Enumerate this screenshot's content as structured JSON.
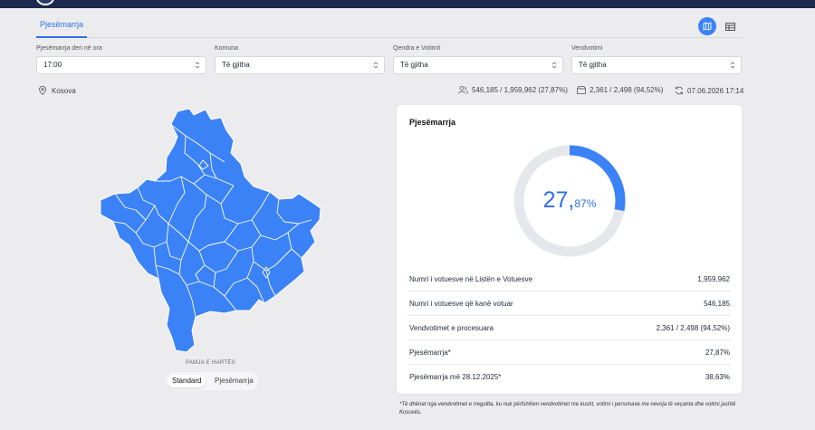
{
  "tabs": {
    "active": "Pjesëmarrja"
  },
  "filters": [
    {
      "label": "Pjesëmarrja deri në ora",
      "value": "17:00"
    },
    {
      "label": "Komuna",
      "value": "Të gjitha"
    },
    {
      "label": "Qendra e Votimit",
      "value": "Të gjitha"
    },
    {
      "label": "Vendvotimi",
      "value": "Të gjitha"
    }
  ],
  "status": {
    "location": "Kosova",
    "voters": "546,185 / 1,959,962 (27,87%)",
    "stations": "2,361 / 2,498 (94,52%)",
    "updated": "07.06.2026 17:14"
  },
  "map": {
    "view_label": "PAMJA E HARTËS",
    "toggle_standard": "Standard",
    "toggle_turnout": "Pjesëmarrja",
    "fill_color": "#3b82f6"
  },
  "card": {
    "title": "Pjesëmarrja",
    "turnout_fraction": 0.2787,
    "turnout_int": "27,",
    "turnout_dec": "87%",
    "rows": [
      {
        "label": "Numri i votuesve në Listën e Votuesve",
        "value": "1,959,962"
      },
      {
        "label": "Numri i votuesve që kanë votuar",
        "value": "546,185"
      },
      {
        "label": "Vendvotimet e procesuara",
        "value": "2,361 / 2,498 (94,52%)"
      },
      {
        "label": "Pjesëmarrja*",
        "value": "27,87%"
      },
      {
        "label": "Pjesëmarrja më 28.12.2025*",
        "value": "38,63%"
      }
    ],
    "note": "*Të dhënat nga vendvotimet e rregullta, ku nuk përfshihen vendvotimet me kusht, votimi i personave me nevoja të veçanta dhe votimi jashtë Kosovës."
  },
  "colors": {
    "accent": "#3b82f6",
    "track": "#e5e7eb",
    "header": "#1c2a4f"
  }
}
